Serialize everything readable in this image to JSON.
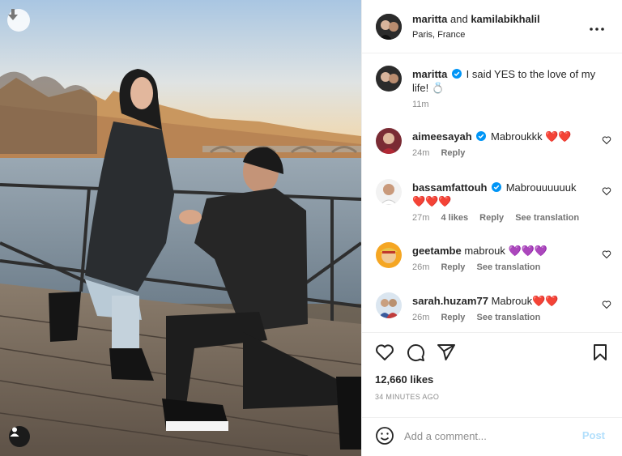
{
  "post": {
    "header": {
      "user1": "maritta",
      "and": "and",
      "user2": "kamilabikhalil",
      "location": "Paris, France",
      "more_icon": "more-horizontal-icon"
    },
    "caption": {
      "username": "maritta",
      "text": "I said YES to the love of my life! 💍",
      "time": "11m"
    },
    "comments": [
      {
        "username": "aimeesayah",
        "verified": true,
        "text": "Mabroukkk",
        "hearts": "❤️❤️",
        "time": "24m",
        "reply": "Reply",
        "likes": "",
        "translate": ""
      },
      {
        "username": "bassamfattouh",
        "verified": true,
        "text": "Mabrouuuuuuk",
        "hearts": "❤️❤️❤️",
        "time": "27m",
        "likes": "4 likes",
        "reply": "Reply",
        "translate": "See translation"
      },
      {
        "username": "geetambe",
        "verified": false,
        "text": "mabrouk",
        "hearts": "💜💜💜",
        "time": "26m",
        "reply": "Reply",
        "translate": "See translation"
      },
      {
        "username": "sarah.huzam77",
        "verified": false,
        "text": "Mabrouk",
        "hearts": "❤️❤️",
        "time": "26m",
        "reply": "Reply",
        "translate": "See translation"
      }
    ],
    "likes": "12,660 likes",
    "time_ago": "34 MINUTES AGO",
    "comment_box": {
      "placeholder": "Add a comment...",
      "post_label": "Post"
    },
    "colors": {
      "verified": "#0095f6",
      "heart_red": "#ed1c24",
      "heart_purple": "#8c5cf5",
      "post_disabled": "#b2dffc",
      "meta_gray": "#8e8e8e"
    }
  }
}
